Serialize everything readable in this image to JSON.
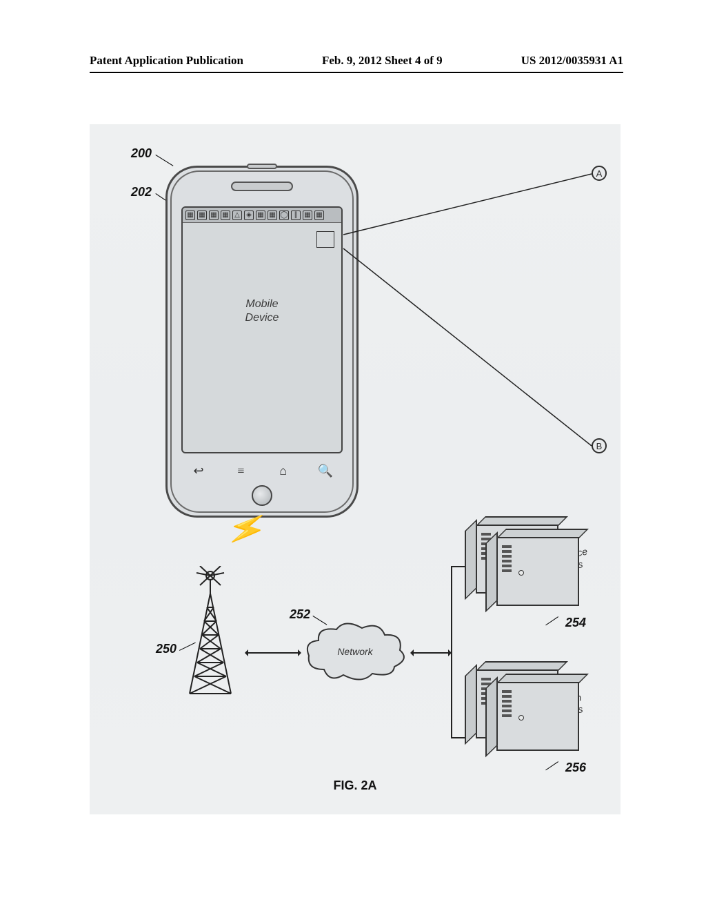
{
  "header": {
    "left": "Patent Application Publication",
    "center": "Feb. 9, 2012  Sheet 4 of 9",
    "right": "US 2012/0035931 A1"
  },
  "refs": {
    "r200": "200",
    "r202": "202",
    "r250": "250",
    "r252": "252",
    "r254": "254",
    "r256": "256"
  },
  "markers": {
    "A": "A",
    "B": "B"
  },
  "phone": {
    "screen_line1": "Mobile",
    "screen_line2": "Device",
    "softkeys": {
      "back": "↩",
      "menu": "≡",
      "home": "⌂",
      "search": "🔍"
    }
  },
  "cloud": {
    "label": "Network"
  },
  "servers": {
    "group1_line1": "Mobile Device",
    "group1_line2": "Server Sys",
    "group2_line1": "Information",
    "group2_line2": "Server Sys"
  },
  "caption": "FIG. 2A"
}
